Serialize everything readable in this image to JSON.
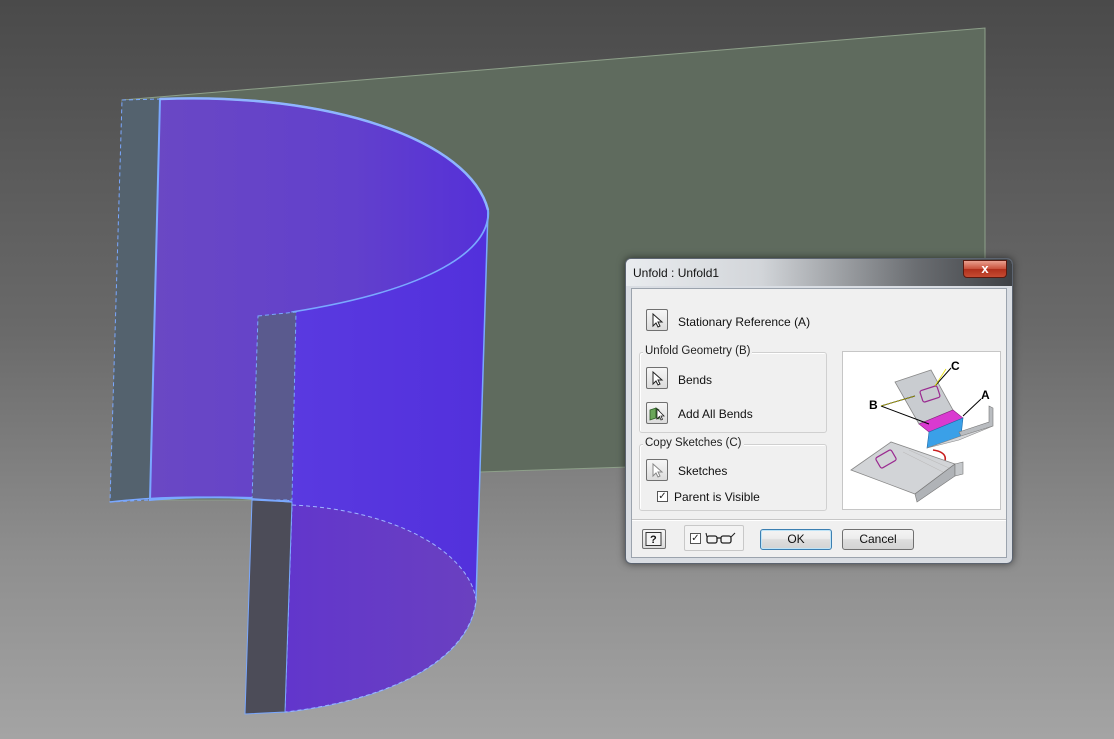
{
  "dialog": {
    "title": "Unfold : Unfold1",
    "close_label": "x",
    "stationary_label": "Stationary Reference (A)",
    "unfold_group_title": "Unfold Geometry (B)",
    "bends_label": "Bends",
    "add_all_bends_label": "Add All Bends",
    "copy_group_title": "Copy Sketches (C)",
    "sketches_label": "Sketches",
    "parent_visible_label": "Parent is Visible",
    "parent_visible_checked": true,
    "preview_checked": true,
    "ok_label": "OK",
    "cancel_label": "Cancel",
    "help_label": "?",
    "diagram_labels": {
      "a": "A",
      "b": "B",
      "c": "C"
    }
  },
  "colors": {
    "part_purple": "#6a45c8",
    "edge_blue": "#7aa8ff",
    "plane_green": "#5f6b5e"
  }
}
